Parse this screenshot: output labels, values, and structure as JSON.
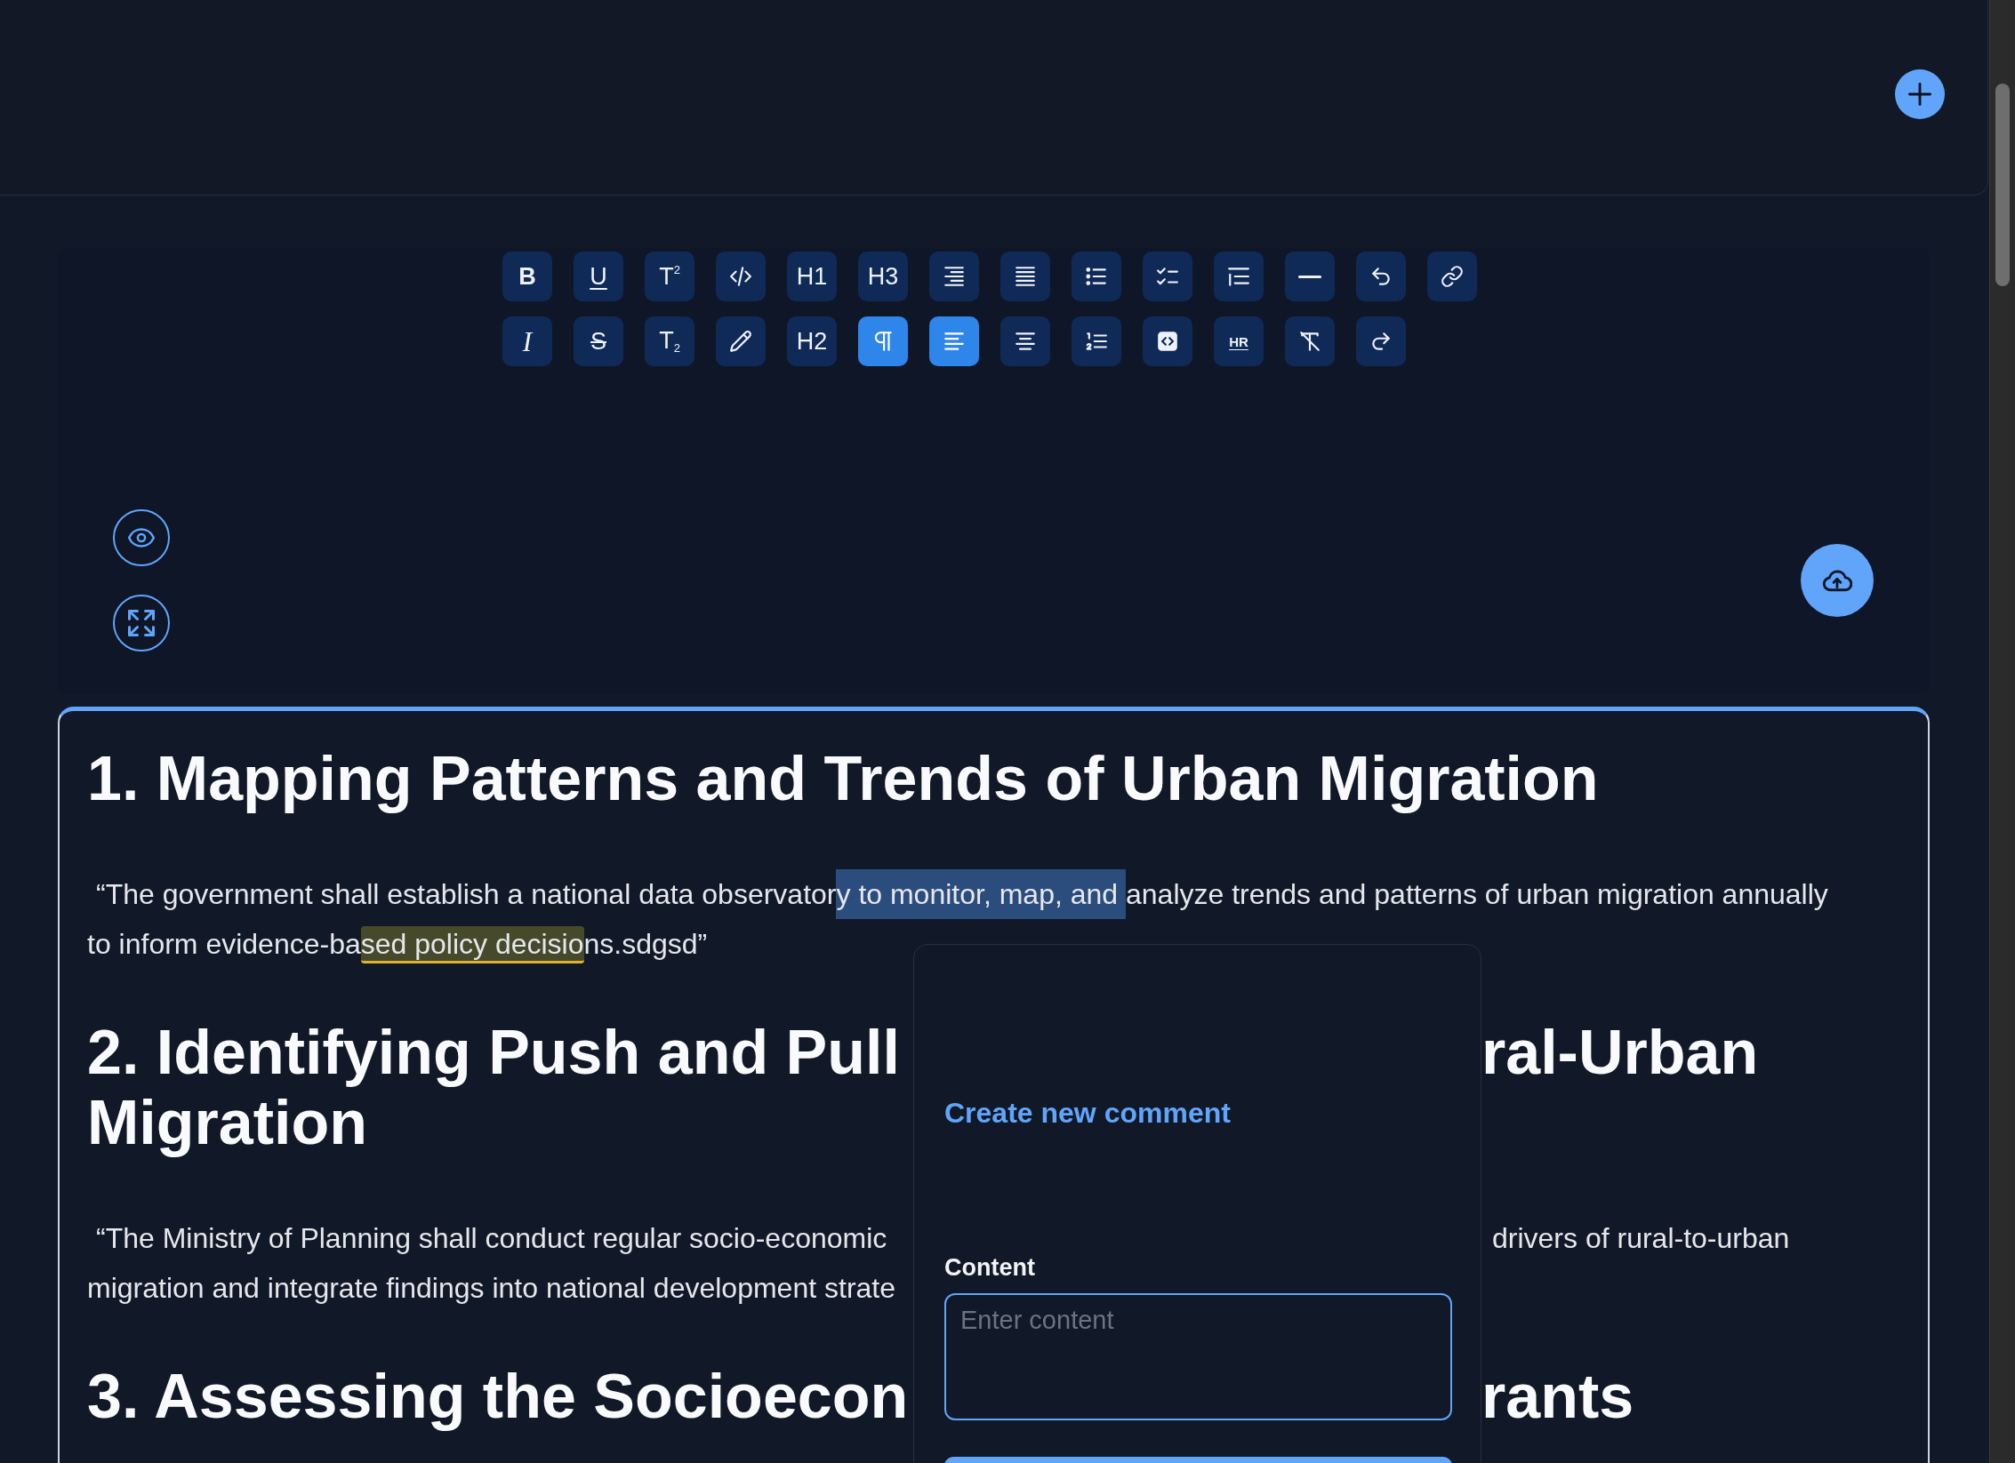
{
  "toolbar": {
    "items": [
      {
        "kind": "bold",
        "label": "B",
        "selected": false
      },
      {
        "kind": "underline",
        "label": "U",
        "selected": false
      },
      {
        "kind": "superscript",
        "label": "T$^{2}$",
        "selected": false
      },
      {
        "kind": "code",
        "selected": false
      },
      {
        "kind": "heading",
        "label": "H1",
        "selected": false
      },
      {
        "kind": "heading",
        "label": "H3",
        "selected": false
      },
      {
        "kind": "align-right",
        "selected": false
      },
      {
        "kind": "align-justify",
        "selected": false
      },
      {
        "kind": "bullet-list",
        "selected": false
      },
      {
        "kind": "task-list",
        "selected": false
      },
      {
        "kind": "blockquote",
        "selected": false
      },
      {
        "kind": "horizontal-rule",
        "selected": false
      },
      {
        "kind": "undo",
        "selected": false
      },
      {
        "kind": "link",
        "selected": false
      },
      {
        "kind": "italic",
        "label": "I",
        "selected": false
      },
      {
        "kind": "strike",
        "label": "S",
        "selected": false
      },
      {
        "kind": "subscript",
        "label": "T$_{2}$",
        "selected": false
      },
      {
        "kind": "highlight",
        "selected": false
      },
      {
        "kind": "heading",
        "label": "H2",
        "selected": false
      },
      {
        "kind": "paragraph",
        "selected": true
      },
      {
        "kind": "align-left",
        "selected": true
      },
      {
        "kind": "align-center",
        "selected": false
      },
      {
        "kind": "ordered-list",
        "selected": false
      },
      {
        "kind": "code-block",
        "selected": false
      },
      {
        "kind": "hr",
        "label": "HR",
        "selected": false
      },
      {
        "kind": "clear-format",
        "selected": false
      },
      {
        "kind": "redo",
        "selected": false
      }
    ]
  },
  "document": {
    "blocks": [
      {
        "kind": "heading",
        "text": "1. Mapping Patterns and Trends of Urban Migration"
      },
      {
        "kind": "paragraph",
        "lines": [
          [
            {
              "kind": "plain",
              "text": "“The government shall establish a national data observator"
            },
            {
              "kind": "selection",
              "text": "y to monitor, map, and "
            },
            {
              "kind": "plain",
              "text": "analyze trends and patterns of urban migration annually"
            }
          ],
          [
            {
              "kind": "plain",
              "text": "to inform evidence-ba"
            },
            {
              "kind": "comment",
              "text": "sed policy decisio"
            },
            {
              "kind": "plain",
              "text": "ns.sdgsd”"
            }
          ]
        ]
      },
      {
        "kind": "heading",
        "rows": [
          {
            "left": "2. Identifying Push and Pull",
            "right": "ral-Urban"
          },
          {
            "left": "Migration"
          }
        ]
      },
      {
        "kind": "paragraph",
        "rows": [
          {
            "left": "“The Ministry of Planning shall conduct regular socio-economic",
            "right": "drivers of rural-to-urban"
          },
          {
            "left": "migration and integrate findings into national development strate"
          }
        ]
      },
      {
        "kind": "heading",
        "rows": [
          {
            "left": "3. Assessing the Socioecon",
            "right": "rants"
          }
        ]
      }
    ]
  },
  "comment_popup": {
    "title": "Create new comment",
    "label": "Content",
    "placeholder": "Enter content"
  }
}
